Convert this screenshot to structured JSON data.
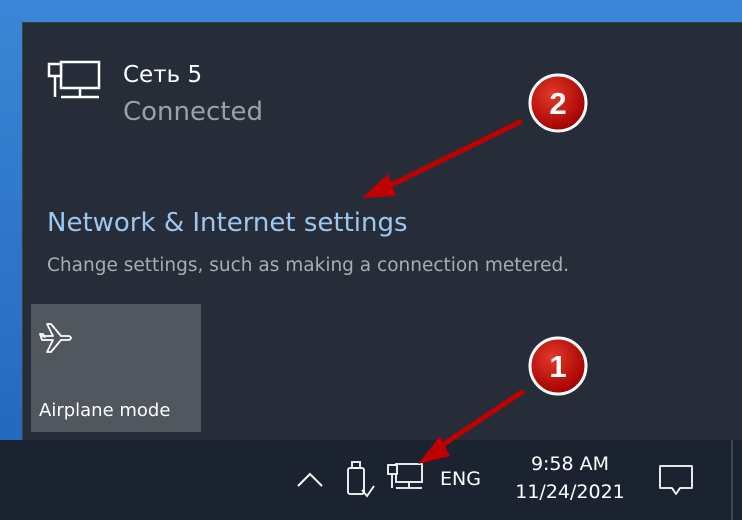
{
  "flyout": {
    "network": {
      "name": "Сеть 5",
      "status": "Connected",
      "icon": "ethernet-network-icon"
    },
    "settings_link": "Network & Internet settings",
    "settings_description": "Change settings, such as making a connection metered.",
    "tiles": [
      {
        "label": "Airplane mode",
        "icon": "airplane-icon"
      }
    ]
  },
  "taskbar": {
    "tray_icons": [
      "chevron-up-icon",
      "usb-safely-remove-icon",
      "network-icon"
    ],
    "language": "ENG",
    "time": "9:58 AM",
    "date": "11/24/2021",
    "notification_icon": "action-center-icon"
  },
  "annotations": {
    "badge_1": "1",
    "badge_2": "2",
    "badge_color": "#c00000",
    "arrow_color": "#c00000"
  },
  "colors": {
    "flyout_bg": "#262d39",
    "taskbar_bg": "#1c2330",
    "link": "#9cc7ef",
    "tile_bg": "#51575f"
  }
}
